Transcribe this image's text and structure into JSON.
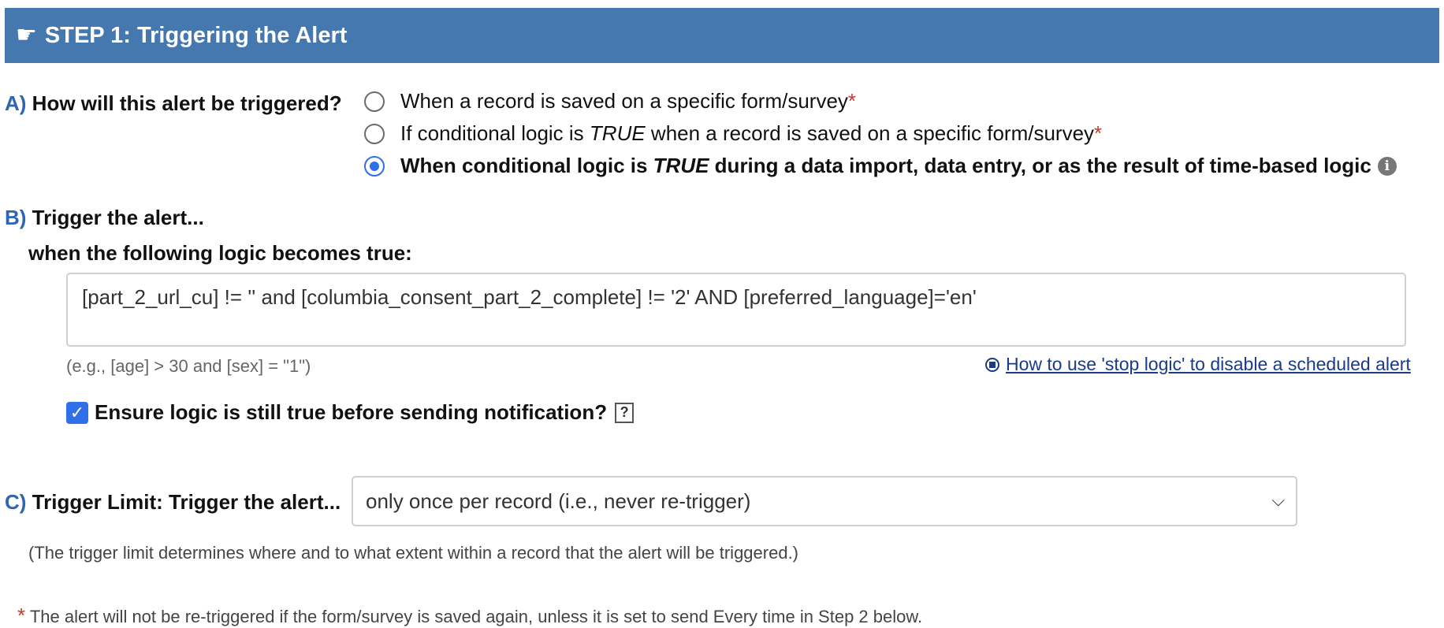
{
  "header": {
    "icon": "pointing-hand-icon",
    "title": "STEP 1: Triggering the Alert"
  },
  "sectionA": {
    "letter": "A)",
    "question": "How will this alert be triggered?",
    "options": [
      {
        "text": "When a record is saved on a specific form/survey",
        "required": "*",
        "selected": false
      },
      {
        "text_before": "If conditional logic is ",
        "text_em": "TRUE",
        "text_after": " when a record is saved on a specific form/survey",
        "required": "*",
        "selected": false
      },
      {
        "text_before": "When conditional logic is ",
        "text_em": "TRUE",
        "text_after": " during a data import, data entry, or as the result of time-based logic",
        "selected": true
      }
    ],
    "info_icon": "info-icon"
  },
  "sectionB": {
    "letter": "B)",
    "title": "Trigger the alert...",
    "subtitle": "when the following logic becomes true:",
    "logic_value": "[part_2_url_cu] != '' and [columbia_consent_part_2_complete] != '2' AND [preferred_language]='en'",
    "example": "(e.g., [age] > 30 and [sex] = \"1\")",
    "stop_logic_link": "How to use 'stop logic' to disable a scheduled alert",
    "ensure_checkbox_label": "Ensure logic is still true before sending notification?",
    "ensure_checked": true,
    "help_label": "?"
  },
  "sectionC": {
    "letter": "C)",
    "title": "Trigger Limit: Trigger the alert...",
    "selected_option": "only once per record (i.e., never re-trigger)",
    "note": "(The trigger limit determines where and to what extent within a record that the alert will be triggered.)"
  },
  "footnote": {
    "marker": "*",
    "text": "The alert will not be re-triggered if the form/survey is saved again, unless it is set to send Every time in Step 2 below."
  },
  "colors": {
    "header_bg": "#4678b0",
    "accent": "#2f6fe8",
    "letter": "#2f66b3",
    "required": "#c0392b"
  }
}
